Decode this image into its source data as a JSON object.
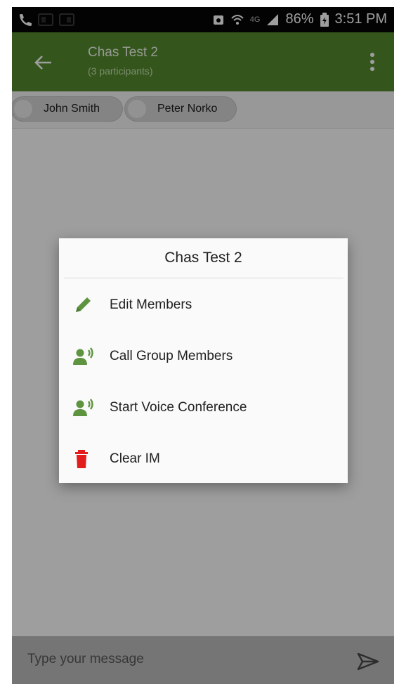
{
  "status_bar": {
    "battery_percent": "86%",
    "time": "3:51 PM",
    "network": "4G"
  },
  "header": {
    "title": "Chas Test 2",
    "subtitle": "(3 participants)"
  },
  "participants": [
    {
      "name": "John Smith"
    },
    {
      "name": "Peter Norko"
    }
  ],
  "dialog": {
    "title": "Chas Test 2",
    "items": [
      {
        "label": "Edit Members",
        "icon": "pencil-icon"
      },
      {
        "label": "Call Group Members",
        "icon": "person-voice-icon"
      },
      {
        "label": "Start Voice Conference",
        "icon": "person-voice-icon"
      },
      {
        "label": "Clear IM",
        "icon": "trash-icon"
      }
    ]
  },
  "composer": {
    "placeholder": "Type your message"
  },
  "colors": {
    "appbar": "#558b2f",
    "icon_green": "#5e9440",
    "icon_red": "#e31c1c"
  }
}
